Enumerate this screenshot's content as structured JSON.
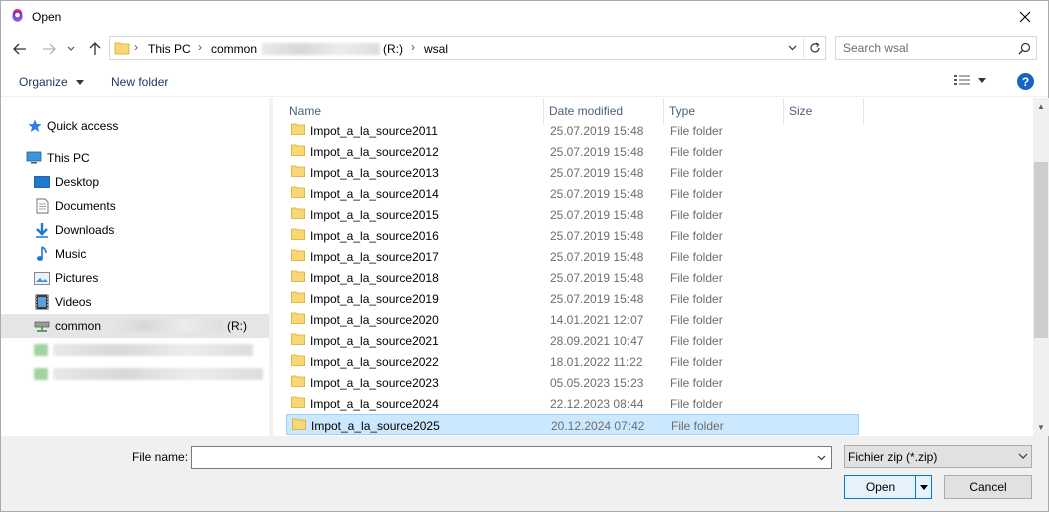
{
  "window": {
    "title": "Open",
    "close_icon": "close-icon"
  },
  "nav": {
    "breadcrumbs": [
      "This PC",
      "common",
      "(R:)",
      "wsal"
    ],
    "search_placeholder": "Search wsal"
  },
  "toolbar": {
    "organize_label": "Organize",
    "new_folder_label": "New folder",
    "help_label": "?"
  },
  "sidebar": {
    "items": [
      {
        "label": "Quick access",
        "icon": "star-icon"
      },
      {
        "label": "This PC",
        "icon": "computer-icon"
      },
      {
        "label": "Desktop",
        "icon": "desktop-icon"
      },
      {
        "label": "Documents",
        "icon": "documents-icon"
      },
      {
        "label": "Downloads",
        "icon": "downloads-icon"
      },
      {
        "label": "Music",
        "icon": "music-icon"
      },
      {
        "label": "Pictures",
        "icon": "pictures-icon"
      },
      {
        "label": "Videos",
        "icon": "videos-icon"
      },
      {
        "label": "common",
        "suffix": "(R:)",
        "icon": "network-drive-icon"
      }
    ]
  },
  "file_list": {
    "columns": [
      "Name",
      "Date modified",
      "Type",
      "Size"
    ],
    "rows": [
      {
        "name": "Impot_a_la_source2011",
        "date": "25.07.2019 15:48",
        "type": "File folder"
      },
      {
        "name": "Impot_a_la_source2012",
        "date": "25.07.2019 15:48",
        "type": "File folder"
      },
      {
        "name": "Impot_a_la_source2013",
        "date": "25.07.2019 15:48",
        "type": "File folder"
      },
      {
        "name": "Impot_a_la_source2014",
        "date": "25.07.2019 15:48",
        "type": "File folder"
      },
      {
        "name": "Impot_a_la_source2015",
        "date": "25.07.2019 15:48",
        "type": "File folder"
      },
      {
        "name": "Impot_a_la_source2016",
        "date": "25.07.2019 15:48",
        "type": "File folder"
      },
      {
        "name": "Impot_a_la_source2017",
        "date": "25.07.2019 15:48",
        "type": "File folder"
      },
      {
        "name": "Impot_a_la_source2018",
        "date": "25.07.2019 15:48",
        "type": "File folder"
      },
      {
        "name": "Impot_a_la_source2019",
        "date": "25.07.2019 15:48",
        "type": "File folder"
      },
      {
        "name": "Impot_a_la_source2020",
        "date": "14.01.2021 12:07",
        "type": "File folder"
      },
      {
        "name": "Impot_a_la_source2021",
        "date": "28.09.2021 10:47",
        "type": "File folder"
      },
      {
        "name": "Impot_a_la_source2022",
        "date": "18.01.2022 11:22",
        "type": "File folder"
      },
      {
        "name": "Impot_a_la_source2023",
        "date": "05.05.2023 15:23",
        "type": "File folder"
      },
      {
        "name": "Impot_a_la_source2024",
        "date": "22.12.2023 08:44",
        "type": "File folder"
      },
      {
        "name": "Impot_a_la_source2025",
        "date": "20.12.2024 07:42",
        "type": "File folder",
        "selected": true
      }
    ]
  },
  "footer": {
    "file_name_label": "File name:",
    "file_name_value": "",
    "filter_value": "Fichier zip (*.zip)",
    "open_label": "Open",
    "cancel_label": "Cancel"
  },
  "colors": {
    "accent": "#0078d7",
    "selection": "#cce8ff",
    "folder": "#f8d775"
  }
}
